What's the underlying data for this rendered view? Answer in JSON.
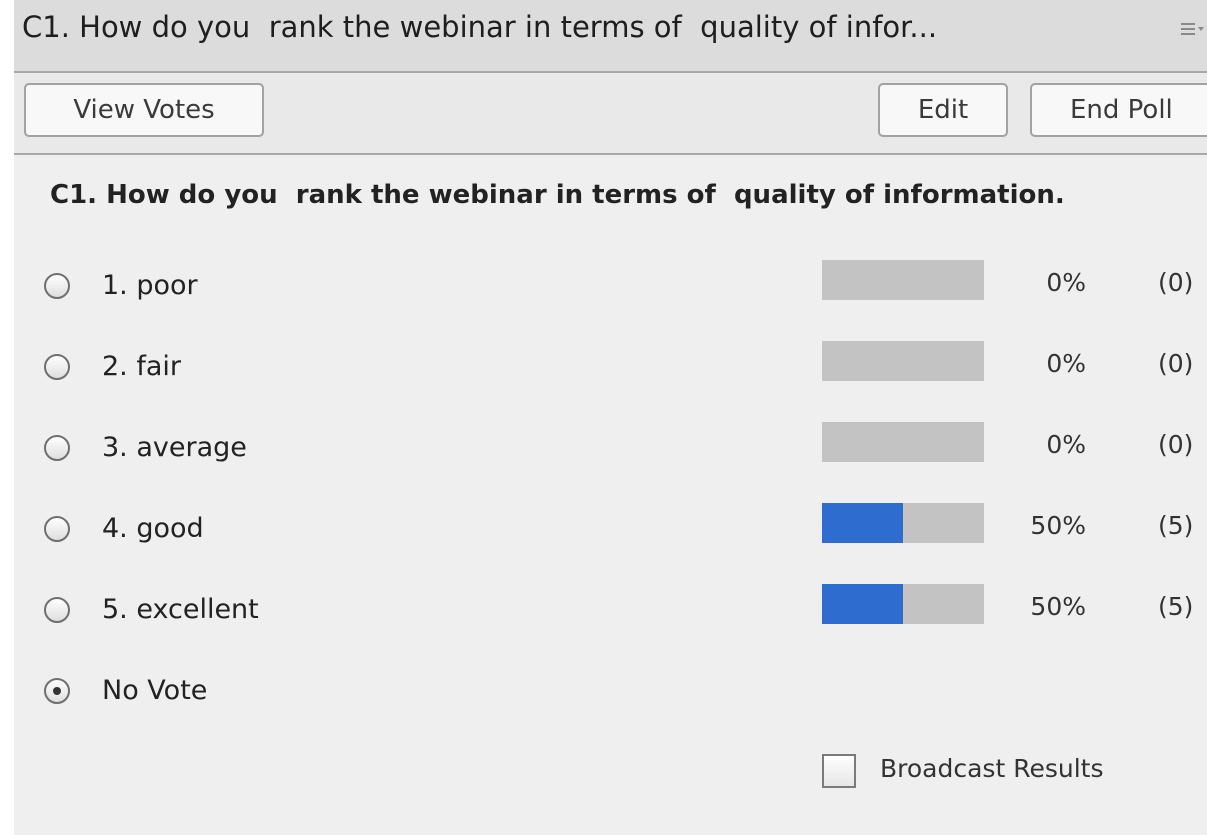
{
  "pod": {
    "title": "C1. How do you  rank the webinar in terms of  quality of infor...",
    "menu_icon": "hamburger-menu-icon"
  },
  "toolbar": {
    "view_votes_label": "View Votes",
    "edit_label": "Edit",
    "end_poll_label": "End Poll"
  },
  "poll": {
    "question": "C1. How do you  rank the webinar in terms of  quality of information.",
    "answers": [
      {
        "label": "1. poor",
        "percent": 0,
        "percent_label": "0%",
        "count_label": "(0)"
      },
      {
        "label": "2. fair",
        "percent": 0,
        "percent_label": "0%",
        "count_label": "(0)"
      },
      {
        "label": "3. average",
        "percent": 0,
        "percent_label": "0%",
        "count_label": "(0)"
      },
      {
        "label": "4. good",
        "percent": 50,
        "percent_label": "50%",
        "count_label": "(5)"
      },
      {
        "label": "5. excellent",
        "percent": 50,
        "percent_label": "50%",
        "count_label": "(5)"
      }
    ],
    "no_vote_label": "No Vote",
    "selected": "No Vote",
    "bar_color": "#2f6ccf",
    "bar_track_color": "#c3c3c3"
  },
  "broadcast": {
    "label": "Broadcast Results",
    "checked": false
  }
}
